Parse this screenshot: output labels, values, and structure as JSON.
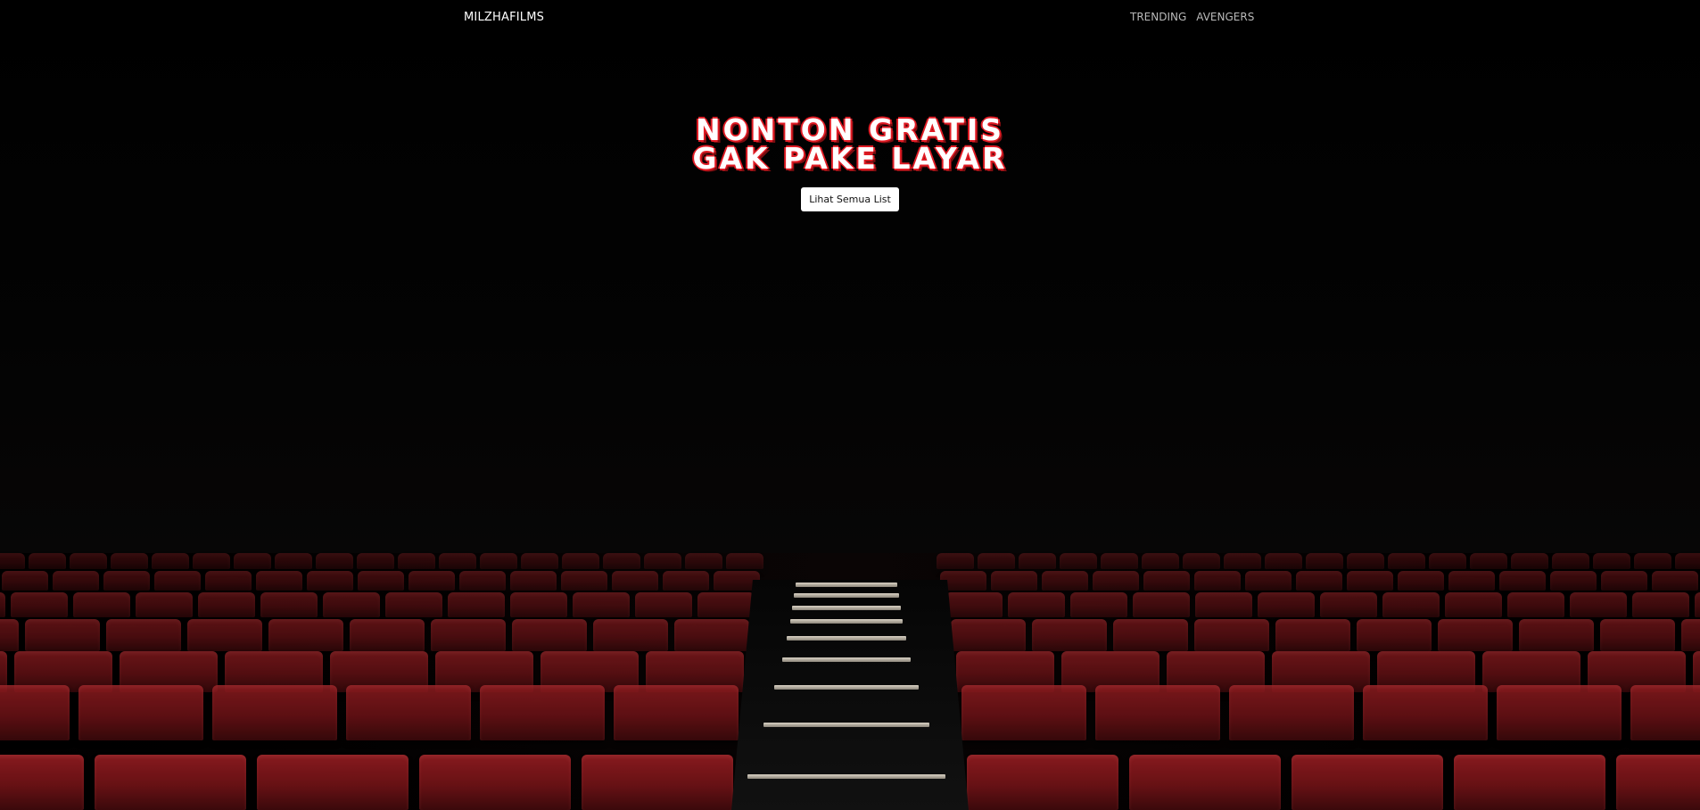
{
  "nav": {
    "brand": "MILZHAFILMS",
    "links": [
      "TRENDING",
      "AVENGERS"
    ]
  },
  "hero": {
    "title_line1": "NONTON GRATIS",
    "title_line2": "GAK PAKE LAYAR",
    "cta_label": "Lihat Semua List"
  },
  "colors": {
    "background": "#000000",
    "seat_red": "#8e1c20",
    "title_outline": "#e01b24",
    "button_bg": "#ffffff"
  }
}
